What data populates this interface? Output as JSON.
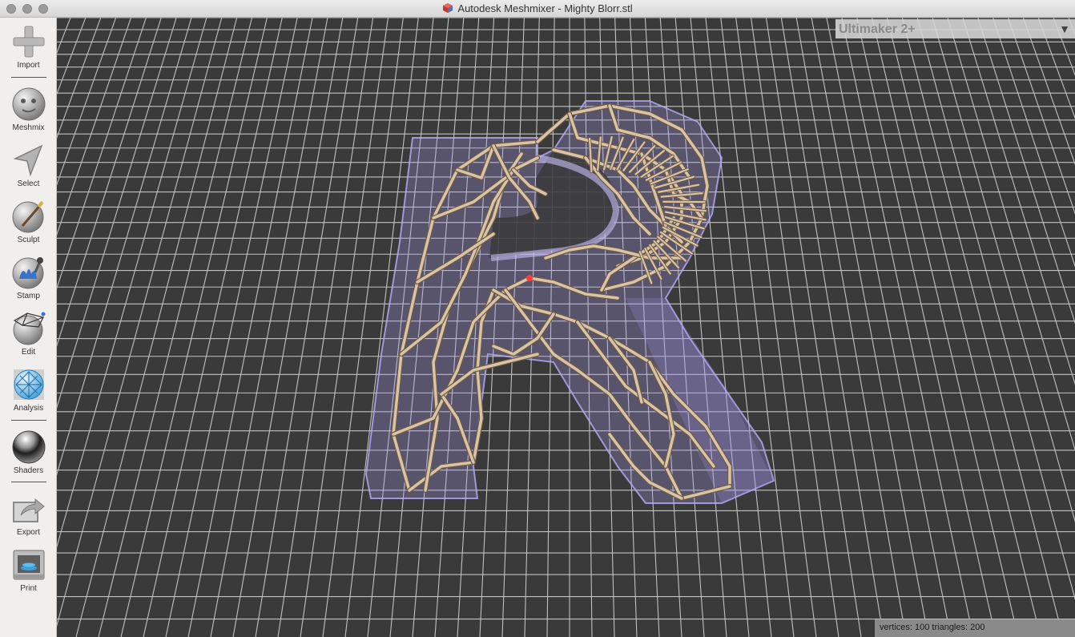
{
  "window": {
    "title": "Autodesk Meshmixer - Mighty Blorr.stl"
  },
  "toolbar": {
    "import": "Import",
    "meshmix": "Meshmix",
    "select": "Select",
    "sculpt": "Sculpt",
    "stamp": "Stamp",
    "edit": "Edit",
    "analysis": "Analysis",
    "shaders": "Shaders",
    "export": "Export",
    "print": "Print"
  },
  "printer": {
    "selected": "Ultimaker 2+"
  },
  "status": {
    "text": "vertices: 100 triangles: 200"
  },
  "colors": {
    "viewport_bg": "#3a3a3a",
    "grid": "#d9d9d9",
    "mesh_overlay": "#a99cf2",
    "lattice": "#d8c4a8"
  }
}
